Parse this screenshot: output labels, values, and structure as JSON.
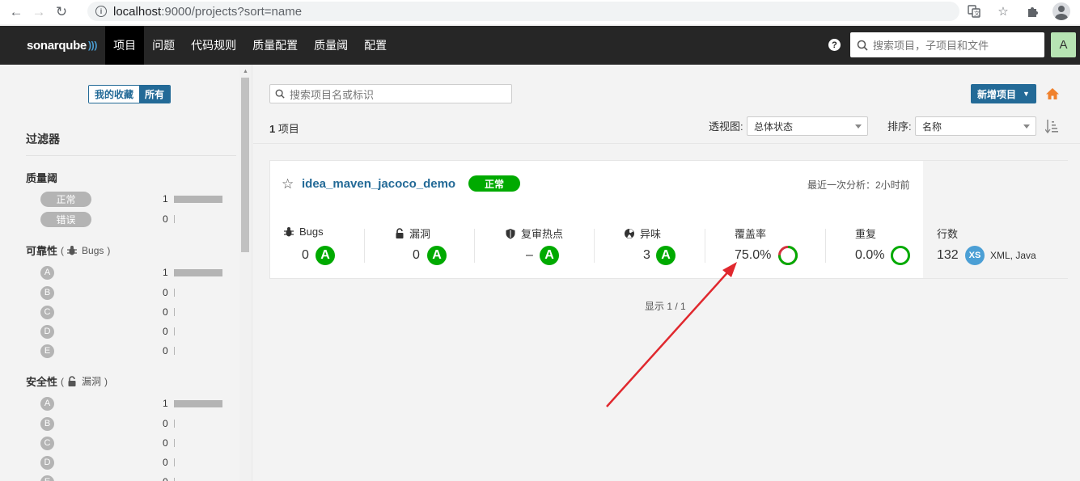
{
  "browser": {
    "url_host": "localhost",
    "url_path": ":9000/projects?sort=name"
  },
  "nav": {
    "logo": "sonarqube",
    "items": [
      {
        "label": "项目",
        "active": true
      },
      {
        "label": "问题",
        "active": false
      },
      {
        "label": "代码规则",
        "active": false
      },
      {
        "label": "质量配置",
        "active": false
      },
      {
        "label": "质量阈",
        "active": false
      },
      {
        "label": "配置",
        "active": false
      }
    ],
    "help": "?",
    "search_placeholder": "搜索项目，子项目和文件",
    "avatar": "A"
  },
  "sidebar": {
    "toggle_favorites": "我的收藏",
    "toggle_all": "所有",
    "filters_title": "过滤器",
    "quality_gate": {
      "title": "质量阈",
      "rows": [
        {
          "label": "正常",
          "count": "1",
          "fraction": 1
        },
        {
          "label": "错误",
          "count": "0",
          "fraction": 0
        }
      ]
    },
    "reliability": {
      "title": "可靠性",
      "sub_open": "(",
      "sub_label": "Bugs",
      "sub_close": ")",
      "rows": [
        {
          "label": "A",
          "count": "1",
          "fraction": 1
        },
        {
          "label": "B",
          "count": "0",
          "fraction": 0
        },
        {
          "label": "C",
          "count": "0",
          "fraction": 0
        },
        {
          "label": "D",
          "count": "0",
          "fraction": 0
        },
        {
          "label": "E",
          "count": "0",
          "fraction": 0
        }
      ]
    },
    "security": {
      "title": "安全性",
      "sub_open": "(",
      "sub_label": "漏洞",
      "sub_close": ")",
      "rows": [
        {
          "label": "A",
          "count": "1",
          "fraction": 1
        },
        {
          "label": "B",
          "count": "0",
          "fraction": 0
        },
        {
          "label": "C",
          "count": "0",
          "fraction": 0
        },
        {
          "label": "D",
          "count": "0",
          "fraction": 0
        },
        {
          "label": "E",
          "count": "0",
          "fraction": 0
        }
      ]
    }
  },
  "main": {
    "search_placeholder": "搜索项目名或标识",
    "new_project_label": "新增项目",
    "project_count_number": "1",
    "project_count_suffix": "项目",
    "perspective_label": "透视图:",
    "perspective_value": "总体状态",
    "sort_label": "排序:",
    "sort_value": "名称",
    "pagination": "显示 1 / 1"
  },
  "project": {
    "name": "idea_maven_jacoco_demo",
    "quality_gate": "正常",
    "last_analysis": "最近一次分析：2小时前",
    "measures": {
      "bugs": {
        "label": "Bugs",
        "value": "0",
        "rating": "A"
      },
      "vulnerabilities": {
        "label": "漏洞",
        "value": "0",
        "rating": "A"
      },
      "hotspots": {
        "label": "复审热点",
        "value": "–",
        "rating": "A"
      },
      "code_smells": {
        "label": "异味",
        "value": "3",
        "rating": "A"
      },
      "coverage": {
        "label": "覆盖率",
        "value": "75.0%",
        "percent": 75.0
      },
      "duplications": {
        "label": "重复",
        "value": "0.0%"
      },
      "lines": {
        "label": "行数",
        "value": "132",
        "size": "XS",
        "languages": "XML, Java"
      }
    }
  },
  "colors": {
    "accent": "#236a97",
    "ok_green": "#00aa00",
    "coverage_red": "#d4333f",
    "annotation_arrow": "#e0282e"
  }
}
